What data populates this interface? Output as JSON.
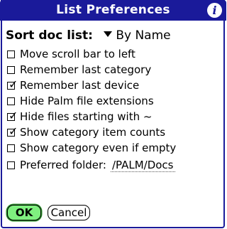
{
  "title": "List Preferences",
  "sort": {
    "label": "Sort doc list:",
    "selected": "By Name"
  },
  "options": [
    {
      "label": "Move scroll bar to left",
      "checked": false
    },
    {
      "label": "Remember last category",
      "checked": false
    },
    {
      "label": "Remember last device",
      "checked": true
    },
    {
      "label": "Hide Palm file extensions",
      "checked": false
    },
    {
      "label": "Hide files starting with ~",
      "checked": true
    },
    {
      "label": "Show category item counts",
      "checked": true
    },
    {
      "label": "Show category even if empty",
      "checked": false
    }
  ],
  "folder": {
    "label": "Preferred folder:",
    "value": "/PALM/Docs",
    "checked": false
  },
  "buttons": {
    "ok": "OK",
    "cancel": "Cancel"
  },
  "check_glyph": "✓",
  "colors": {
    "titlebar": "#1a1a9a",
    "ok_button": "#7ff07f"
  }
}
